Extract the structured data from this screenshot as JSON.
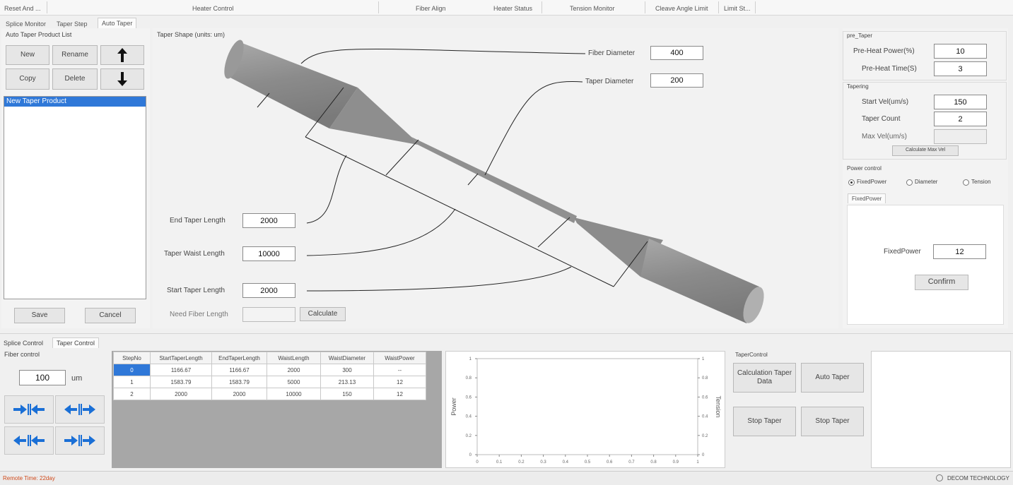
{
  "top_menu": [
    "Reset And ...",
    "Heater Control",
    "Fiber Align",
    "Heater Status",
    "Tension Monitor",
    "Cleave Angle Limit",
    "Limit St..."
  ],
  "tabs": [
    "Splice Monitor",
    "Taper Step",
    "Auto Taper"
  ],
  "product_list": {
    "title": "Auto Taper Product List",
    "new_label": "New",
    "rename_label": "Rename",
    "copy_label": "Copy",
    "delete_label": "Delete",
    "items": [
      "New Taper Product"
    ],
    "save_label": "Save",
    "cancel_label": "Cancel"
  },
  "taper_shape": {
    "title": "Taper Shape (units: um)",
    "fiber_diameter_label": "Fiber Diameter",
    "fiber_diameter_value": "400",
    "taper_diameter_label": "Taper Diameter",
    "taper_diameter_value": "200",
    "end_taper_label": "End Taper Length",
    "end_taper_value": "2000",
    "waist_label": "Taper Waist Length",
    "waist_value": "10000",
    "start_taper_label": "Start Taper Length",
    "start_taper_value": "2000",
    "need_fiber_label": "Need Fiber Length",
    "need_fiber_value": "",
    "calculate_label": "Calculate"
  },
  "pre_taper": {
    "title": "pre_Taper",
    "power_label": "Pre-Heat Power(%)",
    "power_value": "10",
    "time_label": "Pre-Heat Time(S)",
    "time_value": "3"
  },
  "tapering": {
    "title": "Tapering",
    "start_vel_label": "Start Vel(um/s)",
    "start_vel_value": "150",
    "taper_count_label": "Taper Count",
    "taper_count_value": "2",
    "max_vel_label": "Max Vel(um/s)",
    "max_vel_value": "",
    "calc_max_vel_label": "Calculate Max Vel"
  },
  "power_control": {
    "title": "Power control",
    "options": [
      "FixedPower",
      "Diameter",
      "Tension"
    ],
    "tab_label": "FixedPower",
    "fixed_power_label": "FixedPower",
    "fixed_power_value": "12",
    "confirm_label": "Confirm"
  },
  "bottom_tabs": [
    "Splice Control",
    "Taper Control"
  ],
  "fiber_control": {
    "title": "Fiber control",
    "value": "100",
    "unit": "um"
  },
  "steps_table": {
    "headers": [
      "StepNo",
      "StartTaperLength",
      "EndTaperLength",
      "WaistLength",
      "WaistDiameter",
      "WaistPower"
    ],
    "rows": [
      [
        "0",
        "1166.67",
        "1166.67",
        "2000",
        "300",
        "--"
      ],
      [
        "1",
        "1583.79",
        "1583.79",
        "5000",
        "213.13",
        "12"
      ],
      [
        "2",
        "2000",
        "2000",
        "10000",
        "150",
        "12"
      ]
    ]
  },
  "chart_data": {
    "type": "line",
    "title": "",
    "xlabel": "",
    "ylabel": "Power",
    "y2label": "Tension",
    "x_ticks": [
      "0",
      "0.1",
      "0.2",
      "0.3",
      "0.4",
      "0.5",
      "0.6",
      "0.7",
      "0.8",
      "0.9",
      "1"
    ],
    "y_ticks": [
      "0",
      "0.2",
      "0.4",
      "0.6",
      "0.8",
      "1"
    ],
    "y2_ticks": [
      "0",
      "0.2",
      "0.4",
      "0.6",
      "0.8",
      "1"
    ],
    "xlim": [
      0,
      1
    ],
    "ylim": [
      0,
      1
    ],
    "y2lim": [
      0,
      1
    ],
    "series": []
  },
  "taper_control": {
    "title": "TaperControl",
    "calc_label": "Calculation Taper Data",
    "auto_label": "Auto Taper",
    "stop1_label": "Stop Taper",
    "stop2_label": "Stop Taper"
  },
  "status": {
    "left": "Remote Time: 22day",
    "right": "DECOM TECHNOLOGY"
  },
  "colors": {
    "selection": "#2f78d8",
    "arrow_blue": "#1a6fd6",
    "fiber_gray": "#8e8e8e"
  }
}
